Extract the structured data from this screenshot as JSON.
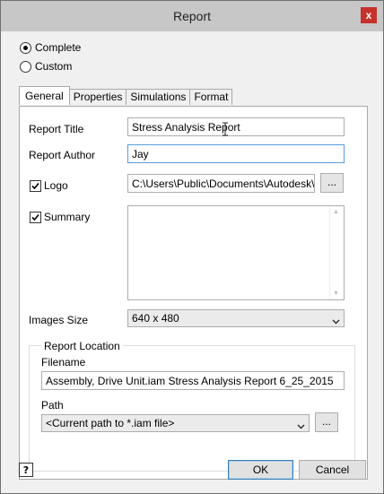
{
  "window": {
    "title": "Report",
    "close_glyph": "x"
  },
  "mode": {
    "options": [
      {
        "label": "Complete",
        "selected": true
      },
      {
        "label": "Custom",
        "selected": false
      }
    ]
  },
  "tabs": [
    {
      "label": "General",
      "active": true
    },
    {
      "label": "Properties",
      "active": false
    },
    {
      "label": "Simulations",
      "active": false
    },
    {
      "label": "Format",
      "active": false
    }
  ],
  "general": {
    "report_title_label": "Report Title",
    "report_title_value": "Stress Analysis Report",
    "report_author_label": "Report Author",
    "report_author_value": "Jay",
    "logo_label": "Logo",
    "logo_checked": true,
    "logo_path": "C:\\Users\\Public\\Documents\\Autodesk\\Inv",
    "logo_browse": "...",
    "summary_label": "Summary",
    "summary_checked": true,
    "summary_text": "",
    "images_size_label": "Images Size",
    "images_size_value": "640 x 480",
    "report_location_label": "Report Location",
    "filename_label": "Filename",
    "filename_value": "Assembly, Drive Unit.iam Stress Analysis Report 6_25_2015",
    "path_label": "Path",
    "path_value": "<Current path to *.iam file>",
    "path_browse": "..."
  },
  "footer": {
    "help_icon": "help-icon",
    "ok_label": "OK",
    "cancel_label": "Cancel"
  },
  "colors": {
    "titlebar": "#c7c7c7",
    "close_button": "#c6312b",
    "focus_border": "#569de5",
    "default_button_border": "#3c7fb1"
  }
}
